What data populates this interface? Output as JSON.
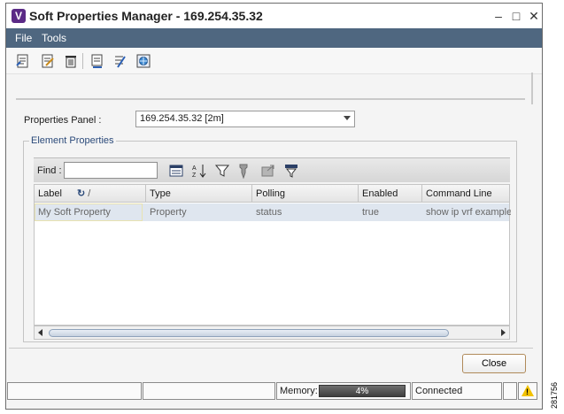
{
  "window": {
    "title": "Soft Properties Manager - 169.254.35.32",
    "app_icon_letter": "V"
  },
  "menu": {
    "items": [
      "File",
      "Tools"
    ]
  },
  "toolbar": {
    "icons": [
      "add-property-icon",
      "edit-property-icon",
      "delete-property-icon",
      "deploy-icon",
      "undeploy-icon",
      "web-icon"
    ]
  },
  "properties_panel": {
    "label": "Properties Panel :",
    "selected": "169.254.35.32 [2m]"
  },
  "element_properties": {
    "legend": "Element Properties",
    "find_label": "Find :",
    "find_value": "",
    "columns": [
      "Label",
      "Type",
      "Polling",
      "Enabled",
      "Command Line"
    ],
    "rows": [
      [
        "My Soft Property",
        "Property",
        "status",
        "true",
        "show ip vrf example"
      ]
    ]
  },
  "buttons": {
    "close": "Close"
  },
  "statusbar": {
    "memory_label": "Memory:",
    "memory_value": "4%",
    "connection": "Connected"
  },
  "side_number": "281756"
}
